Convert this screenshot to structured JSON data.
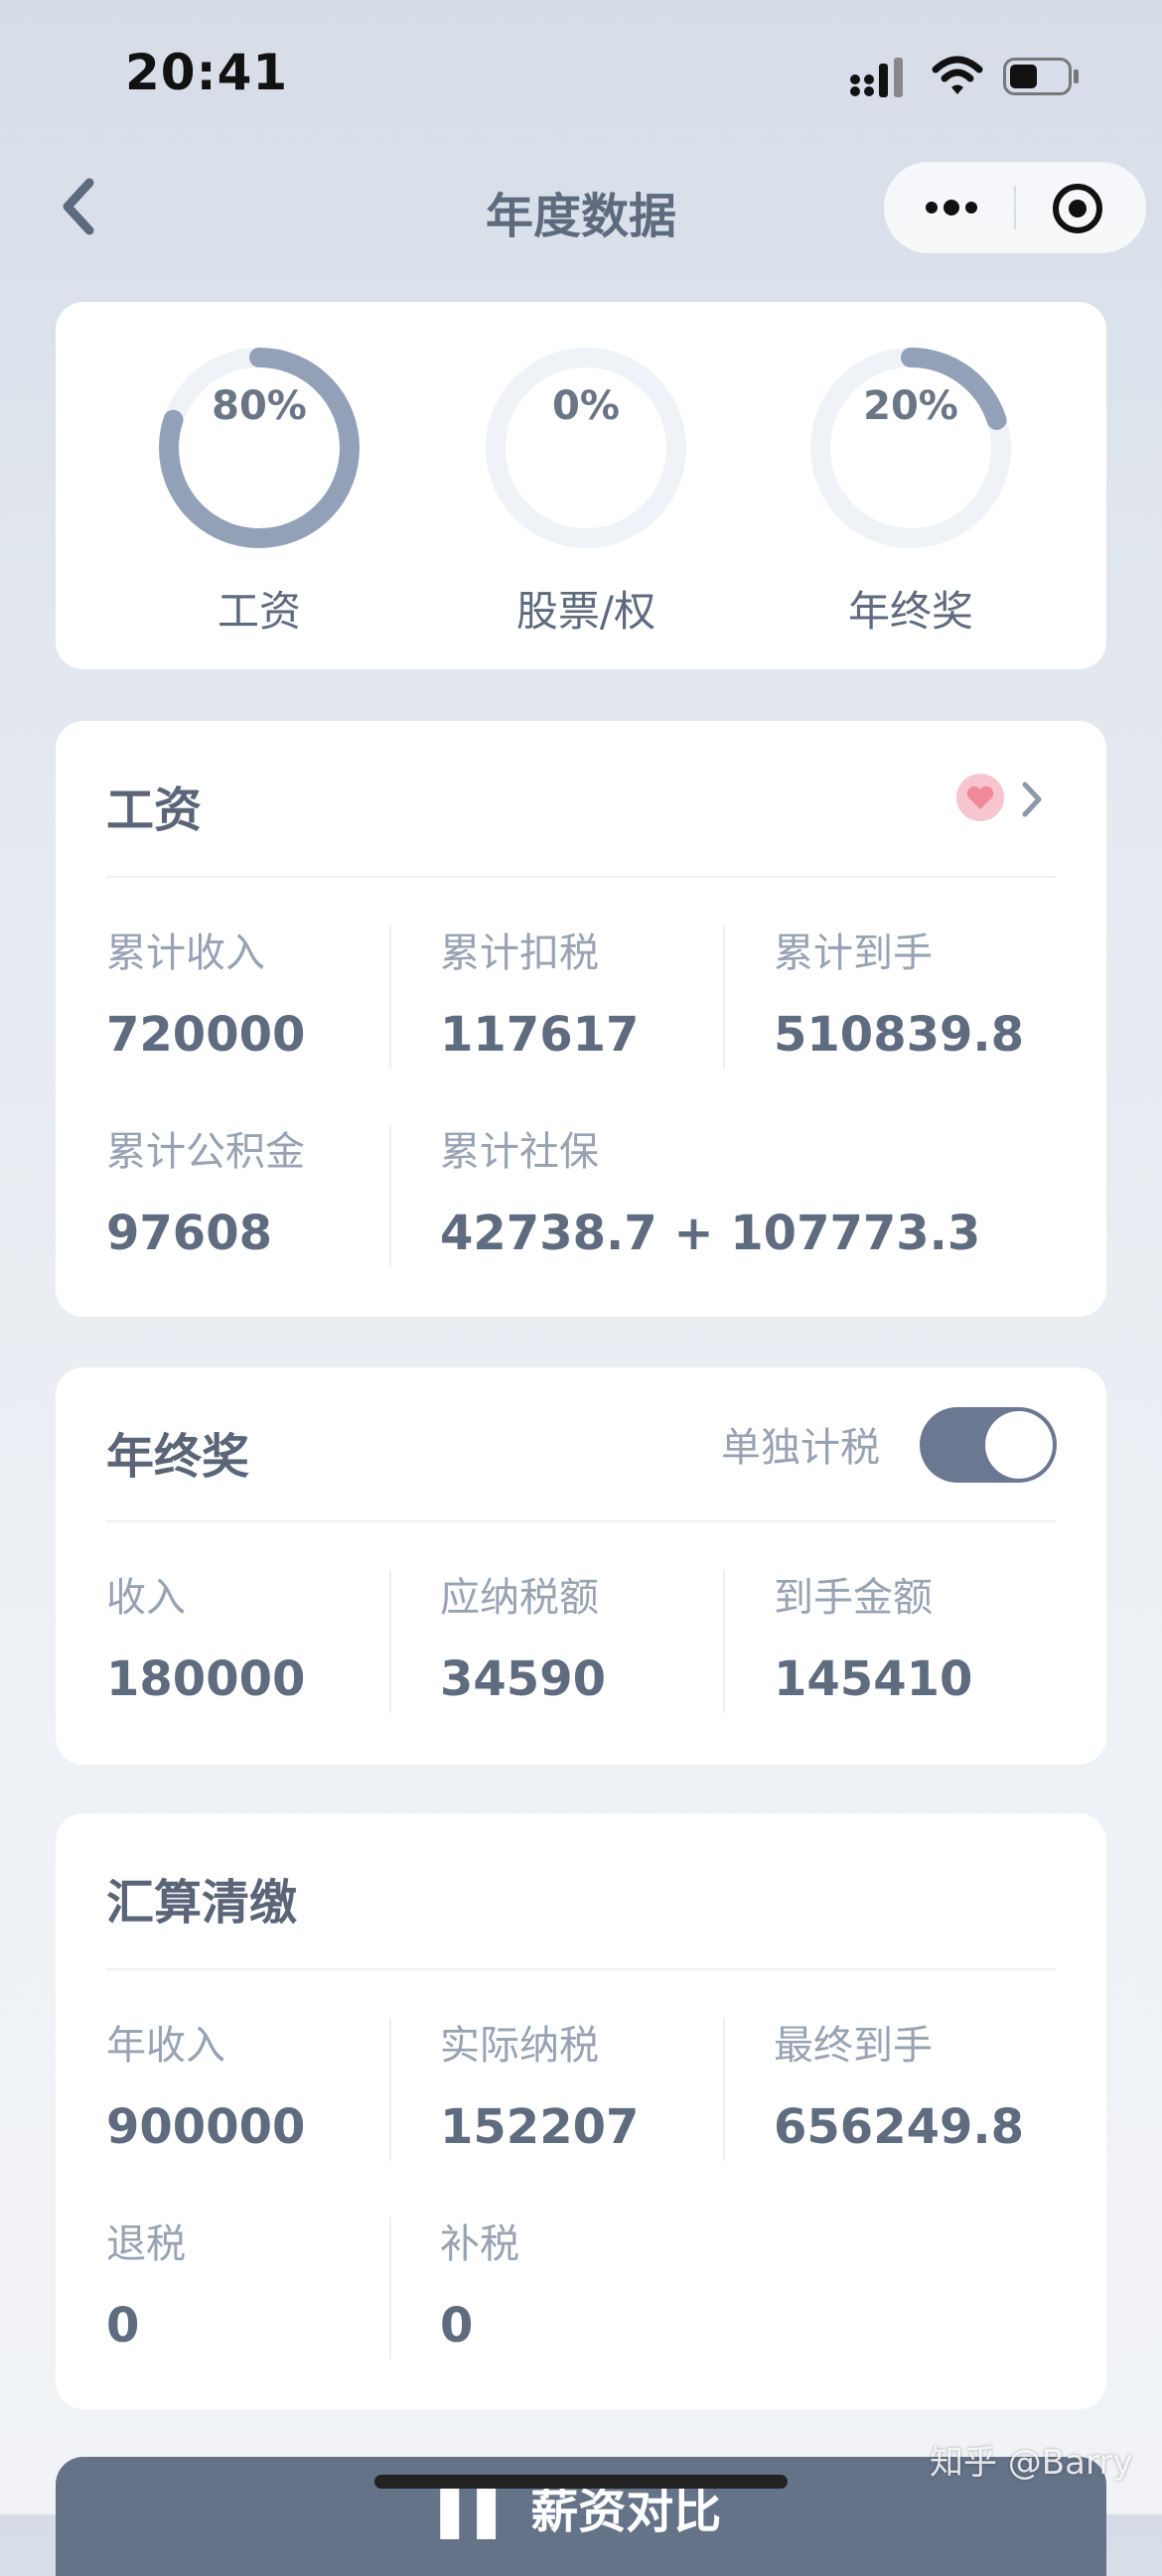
{
  "status_bar": {
    "time": "20:41"
  },
  "nav": {
    "title": "年度数据"
  },
  "rings": [
    {
      "label": "工资",
      "percent_text": "80%",
      "fraction": 0.8
    },
    {
      "label": "股票/权",
      "percent_text": "0%",
      "fraction": 0.0
    },
    {
      "label": "年终奖",
      "percent_text": "20%",
      "fraction": 0.2
    }
  ],
  "salary": {
    "title": "工资",
    "cells": [
      {
        "label": "累计收入",
        "value": "720000"
      },
      {
        "label": "累计扣税",
        "value": "117617"
      },
      {
        "label": "累计到手",
        "value": "510839.8"
      },
      {
        "label": "累计公积金",
        "value": "97608"
      },
      {
        "label": "累计社保",
        "value": "42738.7 + 107773.3"
      }
    ]
  },
  "bonus": {
    "title": "年终奖",
    "toggle_label": "单独计税",
    "toggle_on": true,
    "cells": [
      {
        "label": "收入",
        "value": "180000"
      },
      {
        "label": "应纳税额",
        "value": "34590"
      },
      {
        "label": "到手金额",
        "value": "145410"
      }
    ]
  },
  "settlement": {
    "title": "汇算清缴",
    "cells": [
      {
        "label": "年收入",
        "value": "900000"
      },
      {
        "label": "实际纳税",
        "value": "152207"
      },
      {
        "label": "最终到手",
        "value": "656249.8"
      },
      {
        "label": "退税",
        "value": "0"
      },
      {
        "label": "补税",
        "value": "0"
      }
    ]
  },
  "bottom_button": {
    "label": "▌▌ 薪资对比"
  },
  "watermark": "知乎 @Barry",
  "colors": {
    "ring_fill": "#93a1b8",
    "ring_track": "#eff2f6",
    "toggle_on": "#6a7891",
    "heart": "#f08a9a"
  }
}
